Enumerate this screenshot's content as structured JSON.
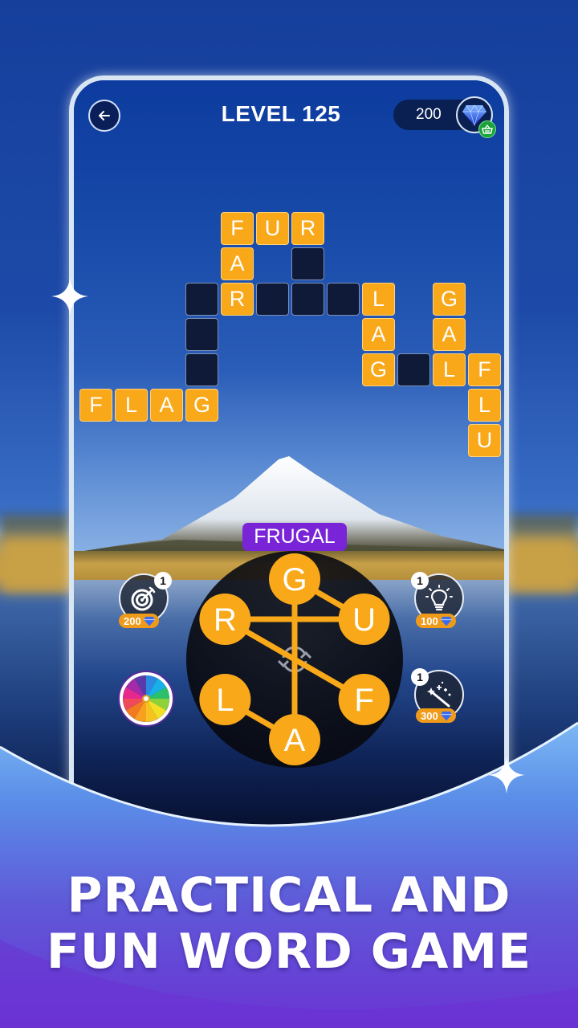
{
  "header": {
    "back_icon": "arrow-left-icon",
    "level_title": "LEVEL 125",
    "gem_count": "200",
    "gem_icon": "diamond-icon",
    "shop_icon": "basket-icon"
  },
  "grid": {
    "tiles": [
      {
        "row": 0,
        "col": 4,
        "letter": "F",
        "state": "filled"
      },
      {
        "row": 0,
        "col": 5,
        "letter": "U",
        "state": "filled"
      },
      {
        "row": 0,
        "col": 6,
        "letter": "R",
        "state": "filled"
      },
      {
        "row": 1,
        "col": 4,
        "letter": "A",
        "state": "filled"
      },
      {
        "row": 1,
        "col": 6,
        "letter": "",
        "state": "empty"
      },
      {
        "row": 2,
        "col": 3,
        "letter": "",
        "state": "empty"
      },
      {
        "row": 2,
        "col": 4,
        "letter": "R",
        "state": "filled"
      },
      {
        "row": 2,
        "col": 5,
        "letter": "",
        "state": "empty"
      },
      {
        "row": 2,
        "col": 6,
        "letter": "",
        "state": "empty"
      },
      {
        "row": 2,
        "col": 7,
        "letter": "",
        "state": "empty"
      },
      {
        "row": 2,
        "col": 8,
        "letter": "L",
        "state": "filled"
      },
      {
        "row": 2,
        "col": 10,
        "letter": "G",
        "state": "filled"
      },
      {
        "row": 3,
        "col": 3,
        "letter": "",
        "state": "empty"
      },
      {
        "row": 3,
        "col": 8,
        "letter": "A",
        "state": "filled"
      },
      {
        "row": 3,
        "col": 10,
        "letter": "A",
        "state": "filled"
      },
      {
        "row": 4,
        "col": 3,
        "letter": "",
        "state": "empty"
      },
      {
        "row": 4,
        "col": 8,
        "letter": "G",
        "state": "filled"
      },
      {
        "row": 4,
        "col": 9,
        "letter": "",
        "state": "empty"
      },
      {
        "row": 4,
        "col": 10,
        "letter": "L",
        "state": "filled"
      },
      {
        "row": 4,
        "col": 11,
        "letter": "F",
        "state": "filled"
      },
      {
        "row": 5,
        "col": 0,
        "letter": "F",
        "state": "filled"
      },
      {
        "row": 5,
        "col": 1,
        "letter": "L",
        "state": "filled"
      },
      {
        "row": 5,
        "col": 2,
        "letter": "A",
        "state": "filled"
      },
      {
        "row": 5,
        "col": 3,
        "letter": "G",
        "state": "filled"
      },
      {
        "row": 5,
        "col": 11,
        "letter": "L",
        "state": "filled"
      },
      {
        "row": 6,
        "col": 11,
        "letter": "U",
        "state": "filled"
      }
    ]
  },
  "current_word": "FRUGAL",
  "wheel": {
    "letters": [
      "G",
      "U",
      "F",
      "A",
      "L",
      "R"
    ],
    "selected_path": [
      "F",
      "R",
      "U",
      "G",
      "A",
      "L"
    ],
    "shuffle_icon": "shuffle-icon"
  },
  "boosters": [
    {
      "name": "target",
      "icon": "target-icon",
      "count": "1",
      "price": "200"
    },
    {
      "name": "hint",
      "icon": "lightbulb-icon",
      "count": "1",
      "price": "100"
    },
    {
      "name": "magic",
      "icon": "magic-wand-icon",
      "count": "1",
      "price": "300"
    }
  ],
  "spin_wheel": {
    "icon": "prize-wheel-icon"
  },
  "colors": {
    "tile_filled": "#f9a81a",
    "tile_empty": "#0e1a38",
    "found_word_bg": "#7a24d8",
    "booster_price_bg": "#f09a1a"
  },
  "tagline": {
    "line1": "PRACTICAL AND",
    "line2": "FUN WORD GAME"
  }
}
